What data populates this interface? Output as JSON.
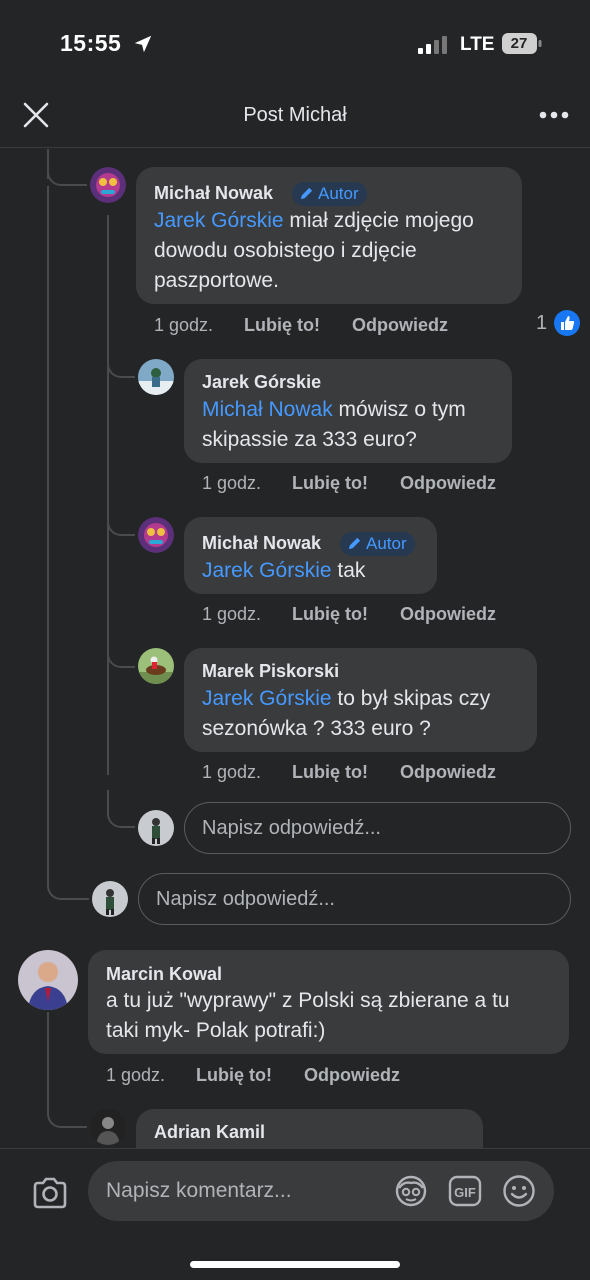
{
  "status": {
    "time": "15:55",
    "network": "LTE",
    "battery": "27"
  },
  "nav": {
    "title": "Post Michał"
  },
  "comments": [
    {
      "author": "Michał Nowak",
      "badge": "Autor",
      "mention": "Jarek Górskie",
      "text_lines": [
        " miał zdjęcie mojego",
        "dowodu osobistego i zdjęcie",
        "paszportowe."
      ],
      "time": "1 godz.",
      "like": "Lubię to!",
      "reply": "Odpowiedz",
      "reaction_count": "1"
    },
    {
      "author": "Jarek Górskie",
      "mention": "Michał Nowak",
      "text_lines": [
        " mówisz o tym",
        "skipassie za 333 euro?"
      ],
      "time": "1 godz.",
      "like": "Lubię to!",
      "reply": "Odpowiedz"
    },
    {
      "author": "Michał Nowak",
      "badge": "Autor",
      "mention": "Jarek Górskie",
      "text_lines": [
        " tak"
      ],
      "time": "1 godz.",
      "like": "Lubię to!",
      "reply": "Odpowiedz"
    },
    {
      "author": "Marek Piskorski",
      "mention": "Jarek Górskie",
      "text_lines": [
        " to był skipas czy",
        "sezonówka ? 333 euro ?"
      ],
      "time": "1 godz.",
      "like": "Lubię to!",
      "reply": "Odpowiedz"
    },
    {
      "author": "Marcin Kowal",
      "text_lines": [
        "a tu już \"wyprawy\" z Polski są zbierane a tu",
        "taki myk- Polak potrafi:)"
      ],
      "time": "1 godz.",
      "like": "Lubię to!",
      "reply": "Odpowiedz"
    },
    {
      "author": "Adrian Kamil"
    }
  ],
  "reply_inputs": {
    "placeholder": "Napisz odpowiedź..."
  },
  "composer": {
    "placeholder": "Napisz komentarz..."
  },
  "icons": [
    "location-arrow-icon",
    "signal-icon",
    "battery-icon",
    "close-icon",
    "more-icon",
    "pencil-icon",
    "like-thumb-icon",
    "camera-icon",
    "avatar-sticker-icon",
    "gif-icon",
    "emoji-icon"
  ],
  "colors": {
    "background": "#242526",
    "bubble": "#3a3b3c",
    "mention": "#4599ff",
    "muted": "#b0b3b8",
    "like_blue": "#1877f2"
  }
}
